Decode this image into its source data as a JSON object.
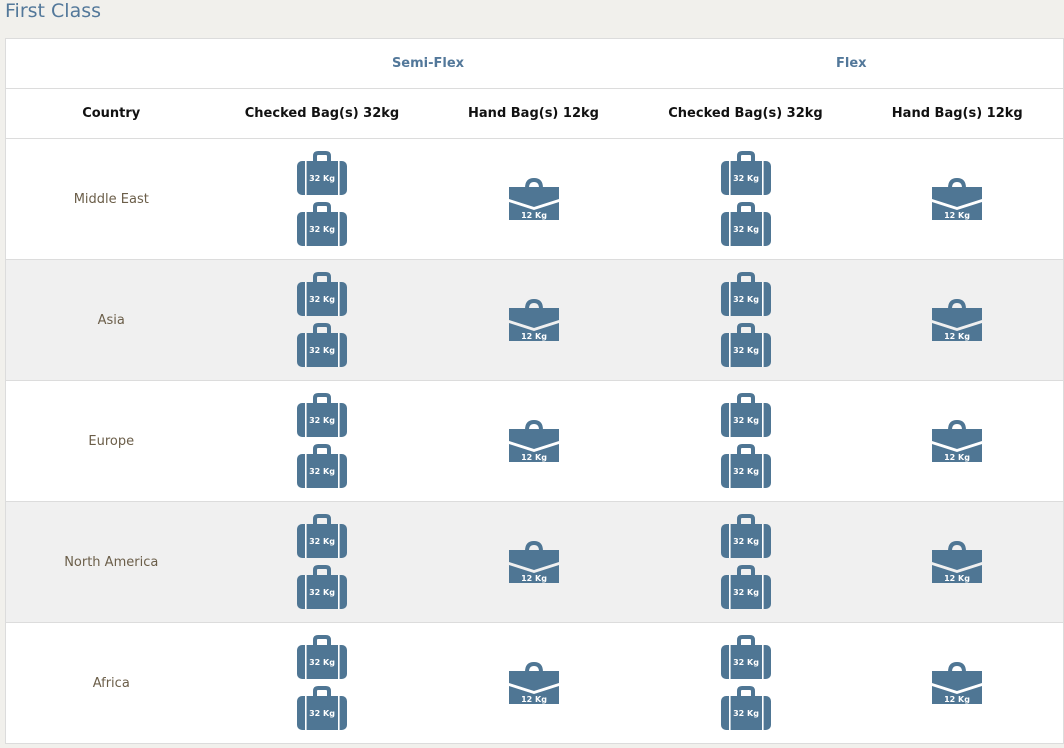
{
  "page": {
    "title": "First Class"
  },
  "table": {
    "fares": [
      "Semi-Flex",
      "Flex"
    ],
    "column_headers": {
      "country": "Country",
      "checked": "Checked Bag(s) 32kg",
      "hand": "Hand Bag(s) 12kg"
    },
    "rows": [
      {
        "country": "Middle East",
        "checked_count": 2,
        "checked_label": "32 Kg",
        "hand_count": 1,
        "hand_label": "12 Kg"
      },
      {
        "country": "Asia",
        "checked_count": 2,
        "checked_label": "32 Kg",
        "hand_count": 1,
        "hand_label": "12 Kg"
      },
      {
        "country": "Europe",
        "checked_count": 2,
        "checked_label": "32 Kg",
        "hand_count": 1,
        "hand_label": "12 Kg"
      },
      {
        "country": "North America",
        "checked_count": 2,
        "checked_label": "32 Kg",
        "hand_count": 1,
        "hand_label": "12 Kg"
      },
      {
        "country": "Africa",
        "checked_count": 2,
        "checked_label": "32 Kg",
        "hand_count": 1,
        "hand_label": "12 Kg"
      }
    ]
  },
  "icons": {
    "checked_bag": "suitcase-icon",
    "hand_bag": "briefcase-icon"
  },
  "colors": {
    "title": "#53789a",
    "icon": "#4f7694",
    "country_text": "#6b5e49",
    "alt_row": "#f0f0f0"
  }
}
